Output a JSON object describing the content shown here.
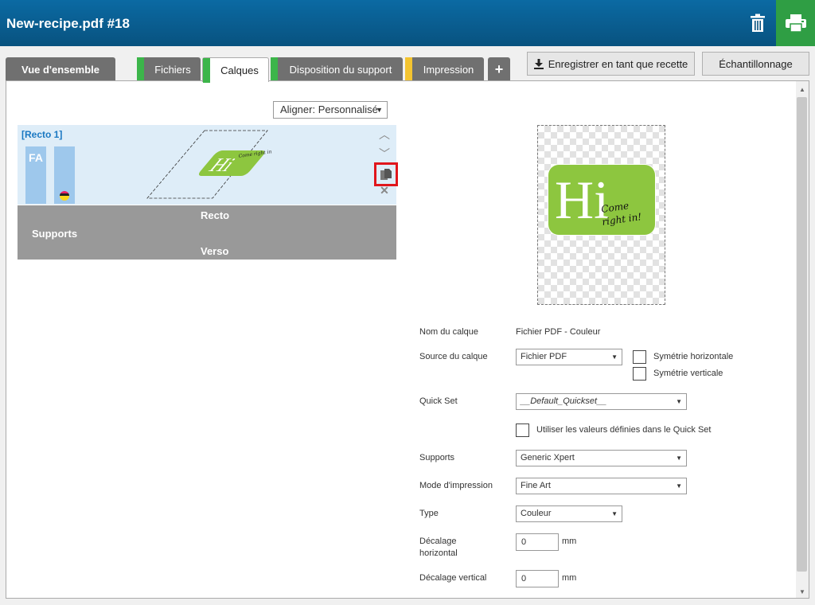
{
  "header": {
    "title": "New-recipe.pdf #18",
    "icons": {
      "trash": "trash-icon",
      "print": "print-icon"
    },
    "print_color": "#2f9e44"
  },
  "tabs": [
    {
      "label": "Vue d'ensemble",
      "marker": null
    },
    {
      "label": "Fichiers",
      "marker": "#3cb54a"
    },
    {
      "label": "Calques",
      "marker": "#3cb54a",
      "active": true
    },
    {
      "label": "Disposition du support",
      "marker": "#3cb54a"
    },
    {
      "label": "Impression",
      "marker": "#f4c430"
    },
    {
      "label": "+"
    }
  ],
  "toolbar": {
    "save_recipe_label": "Enregistrer en tant que recette",
    "sampling_label": "Échantillonnage"
  },
  "align": {
    "label": "Aligner: Personnalisé"
  },
  "layer": {
    "title": "[Recto 1]",
    "bar_label": "FA",
    "logo_text": "Hi",
    "logo_tagline": "Come right in!"
  },
  "supports": {
    "recto": "Recto",
    "label": "Supports",
    "verso": "Verso"
  },
  "preview": {
    "logo_text": "Hi",
    "tagline_line1": "Come",
    "tagline_line2": "right in!",
    "logo_color": "#8dc63f"
  },
  "form": {
    "layer_name_label": "Nom du calque",
    "layer_name_value": "Fichier PDF - Couleur",
    "layer_source_label": "Source du calque",
    "layer_source_value": "Fichier PDF",
    "mirror_horizontal_label": "Symétrie horizontale",
    "mirror_vertical_label": "Symétrie verticale",
    "quickset_label": "Quick Set",
    "quickset_value": "__Default_Quickset__",
    "use_quickset_label": "Utiliser les valeurs définies dans le Quick Set",
    "supports_label": "Supports",
    "supports_value": "Generic Xpert",
    "print_mode_label": "Mode d'impression",
    "print_mode_value": "Fine Art",
    "type_label": "Type",
    "type_value": "Couleur",
    "h_offset_label_1": "Décalage",
    "h_offset_label_2": "horizontal",
    "h_offset_value": "0",
    "h_offset_unit": "mm",
    "v_offset_label": "Décalage vertical",
    "v_offset_value": "0",
    "v_offset_unit": "mm"
  }
}
